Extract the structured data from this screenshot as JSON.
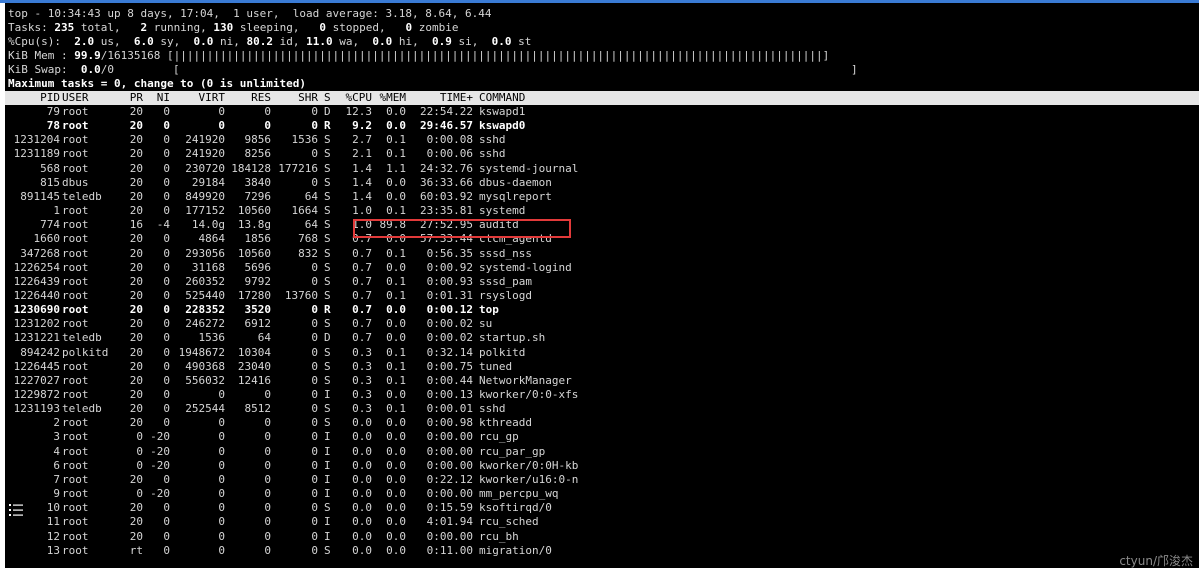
{
  "summary": {
    "line1": "top - 10:34:43 up 8 days, 17:04,  1 user,  load average: 3.18, 8.64, 6.44",
    "tasks": {
      "label": "Tasks:",
      "total": "235",
      "total_label": "total,",
      "running": "2",
      "running_label": "running,",
      "sleeping": "130",
      "sleeping_label": "sleeping,",
      "stopped": "0",
      "stopped_label": "stopped,",
      "zombie": "0",
      "zombie_label": "zombie"
    },
    "cpu": {
      "label": "%Cpu(s):",
      "us": "2.0",
      "us_label": "us,",
      "sy": "6.0",
      "sy_label": "sy,",
      "ni": "0.0",
      "ni_label": "ni,",
      "id": "80.2",
      "id_label": "id,",
      "wa": "11.0",
      "wa_label": "wa,",
      "hi": "0.0",
      "hi_label": "hi,",
      "si": "0.9",
      "si_label": "si,",
      "st": "0.0",
      "st_label": "st"
    },
    "mem": {
      "label": "KiB Mem :",
      "used_pct": "99.9",
      "total": "/16135168",
      "bar": "[||||||||||||||||||||||||||||||||||||||||||||||||||||||||||||||||||||||||||||||||||||||||||||||||||]"
    },
    "swap": {
      "label": "KiB Swap:",
      "value": "0.0",
      "total": "/0",
      "bar_open": "[",
      "bar_close": "]"
    },
    "prompt": "Maximum tasks = 0, change to (0 is unlimited)"
  },
  "columns": [
    "PID",
    "USER",
    "PR",
    "NI",
    "VIRT",
    "RES",
    "SHR",
    "S",
    "%CPU",
    "%MEM",
    "TIME+",
    "COMMAND"
  ],
  "processes": [
    {
      "pid": "79",
      "user": "root",
      "pr": "20",
      "ni": "0",
      "virt": "0",
      "res": "0",
      "shr": "0",
      "s": "D",
      "cpu": "12.3",
      "mem": "0.0",
      "time": "22:54.22",
      "cmd": "kswapd1",
      "bold": false
    },
    {
      "pid": "78",
      "user": "root",
      "pr": "20",
      "ni": "0",
      "virt": "0",
      "res": "0",
      "shr": "0",
      "s": "R",
      "cpu": "9.2",
      "mem": "0.0",
      "time": "29:46.57",
      "cmd": "kswapd0",
      "bold": true
    },
    {
      "pid": "1231204",
      "user": "root",
      "pr": "20",
      "ni": "0",
      "virt": "241920",
      "res": "9856",
      "shr": "1536",
      "s": "S",
      "cpu": "2.7",
      "mem": "0.1",
      "time": "0:00.08",
      "cmd": "sshd",
      "bold": false
    },
    {
      "pid": "1231189",
      "user": "root",
      "pr": "20",
      "ni": "0",
      "virt": "241920",
      "res": "8256",
      "shr": "0",
      "s": "S",
      "cpu": "2.1",
      "mem": "0.1",
      "time": "0:00.06",
      "cmd": "sshd",
      "bold": false
    },
    {
      "pid": "568",
      "user": "root",
      "pr": "20",
      "ni": "0",
      "virt": "230720",
      "res": "184128",
      "shr": "177216",
      "s": "S",
      "cpu": "1.4",
      "mem": "1.1",
      "time": "24:32.76",
      "cmd": "systemd-journal",
      "bold": false
    },
    {
      "pid": "815",
      "user": "dbus",
      "pr": "20",
      "ni": "0",
      "virt": "29184",
      "res": "3840",
      "shr": "0",
      "s": "S",
      "cpu": "1.4",
      "mem": "0.0",
      "time": "36:33.66",
      "cmd": "dbus-daemon",
      "bold": false
    },
    {
      "pid": "891145",
      "user": "teledb",
      "pr": "20",
      "ni": "0",
      "virt": "849920",
      "res": "7296",
      "shr": "64",
      "s": "S",
      "cpu": "1.4",
      "mem": "0.0",
      "time": "60:03.92",
      "cmd": "mysqlreport",
      "bold": false
    },
    {
      "pid": "1",
      "user": "root",
      "pr": "20",
      "ni": "0",
      "virt": "177152",
      "res": "10560",
      "shr": "1664",
      "s": "S",
      "cpu": "1.0",
      "mem": "0.1",
      "time": "23:35.81",
      "cmd": "systemd",
      "bold": false
    },
    {
      "pid": "774",
      "user": "root",
      "pr": "16",
      "ni": "-4",
      "virt": "14.0g",
      "res": "13.8g",
      "shr": "64",
      "s": "S",
      "cpu": "1.0",
      "mem": "89.8",
      "time": "27:52.95",
      "cmd": "auditd",
      "bold": false
    },
    {
      "pid": "1660",
      "user": "root",
      "pr": "20",
      "ni": "0",
      "virt": "4864",
      "res": "1856",
      "shr": "768",
      "s": "S",
      "cpu": "0.7",
      "mem": "0.0",
      "time": "57:33.44",
      "cmd": "ctcm_agentd",
      "bold": false
    },
    {
      "pid": "347268",
      "user": "root",
      "pr": "20",
      "ni": "0",
      "virt": "293056",
      "res": "10560",
      "shr": "832",
      "s": "S",
      "cpu": "0.7",
      "mem": "0.1",
      "time": "0:56.35",
      "cmd": "sssd_nss",
      "bold": false
    },
    {
      "pid": "1226254",
      "user": "root",
      "pr": "20",
      "ni": "0",
      "virt": "31168",
      "res": "5696",
      "shr": "0",
      "s": "S",
      "cpu": "0.7",
      "mem": "0.0",
      "time": "0:00.92",
      "cmd": "systemd-logind",
      "bold": false
    },
    {
      "pid": "1226439",
      "user": "root",
      "pr": "20",
      "ni": "0",
      "virt": "260352",
      "res": "9792",
      "shr": "0",
      "s": "S",
      "cpu": "0.7",
      "mem": "0.1",
      "time": "0:00.93",
      "cmd": "sssd_pam",
      "bold": false
    },
    {
      "pid": "1226440",
      "user": "root",
      "pr": "20",
      "ni": "0",
      "virt": "525440",
      "res": "17280",
      "shr": "13760",
      "s": "S",
      "cpu": "0.7",
      "mem": "0.1",
      "time": "0:01.31",
      "cmd": "rsyslogd",
      "bold": false
    },
    {
      "pid": "1230690",
      "user": "root",
      "pr": "20",
      "ni": "0",
      "virt": "228352",
      "res": "3520",
      "shr": "0",
      "s": "R",
      "cpu": "0.7",
      "mem": "0.0",
      "time": "0:00.12",
      "cmd": "top",
      "bold": true
    },
    {
      "pid": "1231202",
      "user": "root",
      "pr": "20",
      "ni": "0",
      "virt": "246272",
      "res": "6912",
      "shr": "0",
      "s": "S",
      "cpu": "0.7",
      "mem": "0.0",
      "time": "0:00.02",
      "cmd": "su",
      "bold": false
    },
    {
      "pid": "1231221",
      "user": "teledb",
      "pr": "20",
      "ni": "0",
      "virt": "1536",
      "res": "64",
      "shr": "0",
      "s": "D",
      "cpu": "0.7",
      "mem": "0.0",
      "time": "0:00.02",
      "cmd": "startup.sh",
      "bold": false
    },
    {
      "pid": "894242",
      "user": "polkitd",
      "pr": "20",
      "ni": "0",
      "virt": "1948672",
      "res": "10304",
      "shr": "0",
      "s": "S",
      "cpu": "0.3",
      "mem": "0.1",
      "time": "0:32.14",
      "cmd": "polkitd",
      "bold": false
    },
    {
      "pid": "1226445",
      "user": "root",
      "pr": "20",
      "ni": "0",
      "virt": "490368",
      "res": "23040",
      "shr": "0",
      "s": "S",
      "cpu": "0.3",
      "mem": "0.1",
      "time": "0:00.75",
      "cmd": "tuned",
      "bold": false
    },
    {
      "pid": "1227027",
      "user": "root",
      "pr": "20",
      "ni": "0",
      "virt": "556032",
      "res": "12416",
      "shr": "0",
      "s": "S",
      "cpu": "0.3",
      "mem": "0.1",
      "time": "0:00.44",
      "cmd": "NetworkManager",
      "bold": false
    },
    {
      "pid": "1229872",
      "user": "root",
      "pr": "20",
      "ni": "0",
      "virt": "0",
      "res": "0",
      "shr": "0",
      "s": "I",
      "cpu": "0.3",
      "mem": "0.0",
      "time": "0:00.13",
      "cmd": "kworker/0:0-xfs",
      "bold": false
    },
    {
      "pid": "1231193",
      "user": "teledb",
      "pr": "20",
      "ni": "0",
      "virt": "252544",
      "res": "8512",
      "shr": "0",
      "s": "S",
      "cpu": "0.3",
      "mem": "0.1",
      "time": "0:00.01",
      "cmd": "sshd",
      "bold": false
    },
    {
      "pid": "2",
      "user": "root",
      "pr": "20",
      "ni": "0",
      "virt": "0",
      "res": "0",
      "shr": "0",
      "s": "S",
      "cpu": "0.0",
      "mem": "0.0",
      "time": "0:00.98",
      "cmd": "kthreadd",
      "bold": false
    },
    {
      "pid": "3",
      "user": "root",
      "pr": "0",
      "ni": "-20",
      "virt": "0",
      "res": "0",
      "shr": "0",
      "s": "I",
      "cpu": "0.0",
      "mem": "0.0",
      "time": "0:00.00",
      "cmd": "rcu_gp",
      "bold": false
    },
    {
      "pid": "4",
      "user": "root",
      "pr": "0",
      "ni": "-20",
      "virt": "0",
      "res": "0",
      "shr": "0",
      "s": "I",
      "cpu": "0.0",
      "mem": "0.0",
      "time": "0:00.00",
      "cmd": "rcu_par_gp",
      "bold": false
    },
    {
      "pid": "6",
      "user": "root",
      "pr": "0",
      "ni": "-20",
      "virt": "0",
      "res": "0",
      "shr": "0",
      "s": "I",
      "cpu": "0.0",
      "mem": "0.0",
      "time": "0:00.00",
      "cmd": "kworker/0:0H-kb",
      "bold": false
    },
    {
      "pid": "7",
      "user": "root",
      "pr": "20",
      "ni": "0",
      "virt": "0",
      "res": "0",
      "shr": "0",
      "s": "I",
      "cpu": "0.0",
      "mem": "0.0",
      "time": "0:22.12",
      "cmd": "kworker/u16:0-n",
      "bold": false
    },
    {
      "pid": "9",
      "user": "root",
      "pr": "0",
      "ni": "-20",
      "virt": "0",
      "res": "0",
      "shr": "0",
      "s": "I",
      "cpu": "0.0",
      "mem": "0.0",
      "time": "0:00.00",
      "cmd": "mm_percpu_wq",
      "bold": false
    },
    {
      "pid": "10",
      "user": "root",
      "pr": "20",
      "ni": "0",
      "virt": "0",
      "res": "0",
      "shr": "0",
      "s": "S",
      "cpu": "0.0",
      "mem": "0.0",
      "time": "0:15.59",
      "cmd": "ksoftirqd/0",
      "bold": false
    },
    {
      "pid": "11",
      "user": "root",
      "pr": "20",
      "ni": "0",
      "virt": "0",
      "res": "0",
      "shr": "0",
      "s": "I",
      "cpu": "0.0",
      "mem": "0.0",
      "time": "4:01.94",
      "cmd": "rcu_sched",
      "bold": false
    },
    {
      "pid": "12",
      "user": "root",
      "pr": "20",
      "ni": "0",
      "virt": "0",
      "res": "0",
      "shr": "0",
      "s": "I",
      "cpu": "0.0",
      "mem": "0.0",
      "time": "0:00.00",
      "cmd": "rcu_bh",
      "bold": false
    },
    {
      "pid": "13",
      "user": "root",
      "pr": "rt",
      "ni": "0",
      "virt": "0",
      "res": "0",
      "shr": "0",
      "s": "S",
      "cpu": "0.0",
      "mem": "0.0",
      "time": "0:11.00",
      "cmd": "migration/0",
      "bold": false
    }
  ],
  "watermark": "ctyun/邝浚杰",
  "icons": {
    "menu": "list-menu-icon"
  },
  "colors": {
    "terminal_bg": "#000000",
    "text": "#d6d6d6",
    "header_bg": "#e6e6e6",
    "highlight": "#e23a3a",
    "accent": "#3a7bd5"
  }
}
